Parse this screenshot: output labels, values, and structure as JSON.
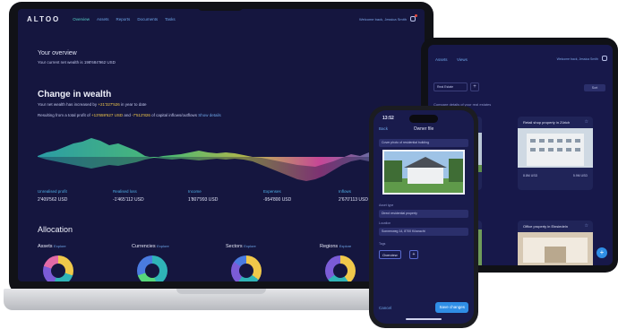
{
  "laptop": {
    "logo": "ALTOO",
    "nav": [
      "Overview",
      "Assets",
      "Reports",
      "Documents",
      "Tasks"
    ],
    "user": "Welcome back, Jessica Smith",
    "overview_title": "Your overview",
    "overview_sub": "Your current net wealth is 198'684'962 USD",
    "change_title": "Change in wealth",
    "change_sub1_pre": "Your net wealth has increased by ",
    "change_sub1_hl": "+21'327'526",
    "change_sub1_post": " in year to date",
    "change_sub2_pre": "Resulting from a total profit of ",
    "change_sub2_hl": "+13'659'627 USD",
    "change_sub2_mid": " and ",
    "change_sub2_hl2": "-7'512'826",
    "change_sub2_post": " of capital inflows/outflows",
    "change_sub2_link": "Show details",
    "stats": [
      {
        "label": "Unrealised profit",
        "value": "2'409'562 USD"
      },
      {
        "label": "Realised loss",
        "value": "-1'465'112 USD"
      },
      {
        "label": "Income",
        "value": "1'807'993 USD"
      },
      {
        "label": "Expenses",
        "value": "-954'800 USD"
      },
      {
        "label": "Inflows",
        "value": "2'670'113 USD"
      }
    ],
    "allocation_title": "Allocation",
    "allocation": [
      {
        "title": "Assets",
        "link": "Explore"
      },
      {
        "title": "Currencies",
        "link": "Explore"
      },
      {
        "title": "Sectors",
        "link": "Explore"
      },
      {
        "title": "Regions",
        "link": "Explore"
      }
    ]
  },
  "tablet": {
    "tabs": [
      "Assets",
      "Views"
    ],
    "user": "Welcome back, Jessica Smith",
    "filter": "Real Estate",
    "add": "+",
    "sort": "Sort",
    "hint": "Compare details of your real estates",
    "cards": [
      {
        "title": "Detached property in Zurich",
        "a": "",
        "b": ""
      },
      {
        "title": "Retail shop property in Zürich",
        "a": "8.8M USD",
        "b": "5.9M USD"
      },
      {
        "title": "",
        "a": "",
        "b": ""
      },
      {
        "title": "Office property in Einsiedeln",
        "a": "",
        "b": ""
      }
    ],
    "fab": "+"
  },
  "phone": {
    "time": "13:52",
    "back": "Back",
    "title": "Owner file",
    "photo_caption": "Cover photo of residential building",
    "field1_label": "Asset type",
    "field1_value": "Direct residential property",
    "field2_label": "Location",
    "field2_value": "Sonnenweg 14, 8700 Küsnacht",
    "field3_label": "Tags",
    "chip": "Overview",
    "chip_add": "+",
    "cancel": "Cancel",
    "save": "Save changes"
  }
}
